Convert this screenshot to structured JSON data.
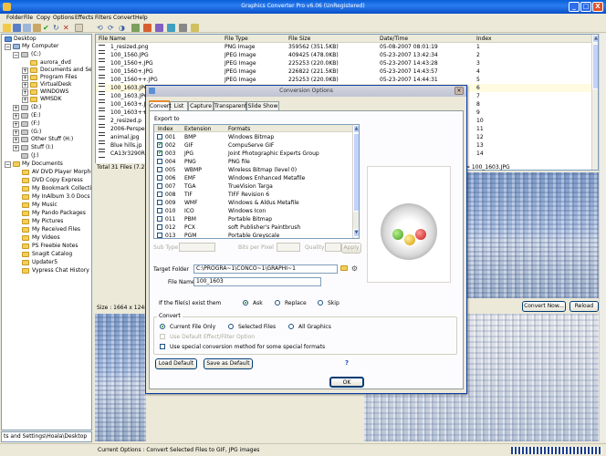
{
  "window": {
    "title": "Graphics Converter Pro v6.06 (UnRegistered)",
    "min": "_",
    "max": "□",
    "close": "X"
  },
  "menu": [
    "Folder",
    "File",
    "Copy",
    "Options",
    "Effects",
    "Filters",
    "Convert",
    "Help"
  ],
  "tree": {
    "items": [
      {
        "label": "Desktop"
      },
      {
        "label": "My Computer"
      },
      {
        "label": "(C:)"
      },
      {
        "label": "aurora_dvd"
      },
      {
        "label": "Documents and Settings"
      },
      {
        "label": "Program Files"
      },
      {
        "label": "VirtualDesk"
      },
      {
        "label": "WINDOWS"
      },
      {
        "label": "WMSDK"
      },
      {
        "label": "(D:)"
      },
      {
        "label": "(E:)"
      },
      {
        "label": "(F:)"
      },
      {
        "label": "(G:)"
      },
      {
        "label": "Other Stuff (H:)"
      },
      {
        "label": "Stuff (I:)"
      },
      {
        "label": "(J:)"
      },
      {
        "label": "My Documents"
      },
      {
        "label": "AV DVD Player Morpher"
      },
      {
        "label": "DVD Copy Express"
      },
      {
        "label": "My Bookmark Collections"
      },
      {
        "label": "My InAlbum 3.0 Docs"
      },
      {
        "label": "My Music"
      },
      {
        "label": "My Pando Packages"
      },
      {
        "label": "My Pictures"
      },
      {
        "label": "My Received Files"
      },
      {
        "label": "My Videos"
      },
      {
        "label": "PS Freebie Notes"
      },
      {
        "label": "SnagIt Catalog"
      },
      {
        "label": "Updater5"
      },
      {
        "label": "Vypress Chat History"
      }
    ],
    "path": "ts and Settings\\Hoala\\Desktop"
  },
  "files": {
    "headers": [
      "File Name",
      "File Type",
      "File Size",
      "Date/Time",
      "Index"
    ],
    "rows": [
      [
        "1_resized.png",
        "PNG Image",
        "359562 (351.5KB)",
        "05-08-2007  08:01:19",
        "1"
      ],
      [
        "100_1560.JPG",
        "JPEG Image",
        "409425 (478.0KB)",
        "05-23-2007  13:42:34",
        "2"
      ],
      [
        "100_1560+.JPG",
        "JPEG Image",
        "225253 (220.0KB)",
        "05-23-2007  14:43:28",
        "3"
      ],
      [
        "100_1560+.JPG",
        "JPEG Image",
        "226822 (221.5KB)",
        "05-23-2007  14:43:57",
        "4"
      ],
      [
        "100_1560++.JPG",
        "JPEG Image",
        "225253 (220.0KB)",
        "05-23-2007  14:44:31",
        "5"
      ],
      [
        "100_1603.JPG",
        "",
        "",
        "",
        "6"
      ],
      [
        "100_1603.JPG",
        "",
        "",
        "",
        "7"
      ],
      [
        "100_1603+.J",
        "",
        "",
        "",
        "8"
      ],
      [
        "100_1603++.J",
        "",
        "",
        "",
        "9"
      ],
      [
        "2_resized.p",
        "",
        "",
        "",
        "10"
      ],
      [
        "2006-Perspe",
        "",
        "",
        "",
        "11"
      ],
      [
        "animal.jpg",
        "",
        "",
        "",
        "12"
      ],
      [
        "Blue hills.jp",
        "",
        "",
        "",
        "13"
      ],
      [
        "CA13r3290R",
        "",
        "",
        "",
        "14"
      ]
    ],
    "total": "Total 31 Files (7.2 M"
  },
  "preview": {
    "filename": "= 100_1603.JPG",
    "size": "Size : 1664 x 1248",
    "convert_now": "Convert Now...",
    "reload": "Reload"
  },
  "status": "Current Options : Convert Selected Files to GIF, JPG images",
  "dialog": {
    "title": "Conversion Options",
    "tabs": [
      "Convert",
      "List",
      "Capture",
      "Transparent",
      "Slide Show"
    ],
    "export_to": "Export to",
    "format_headers": [
      "Index",
      "Extension",
      "Formats"
    ],
    "formats": [
      {
        "index": "001",
        "ext": "BMP",
        "name": "Windows Bitmap",
        "checked": false
      },
      {
        "index": "002",
        "ext": "GIF",
        "name": "CompuServe GIF",
        "checked": true
      },
      {
        "index": "003",
        "ext": "JPG",
        "name": "Joint Photographic Experts Group",
        "checked": true
      },
      {
        "index": "004",
        "ext": "PNG",
        "name": "PNG file",
        "checked": false
      },
      {
        "index": "005",
        "ext": "WBMP",
        "name": "Wireless Bitmap (level 0)",
        "checked": false
      },
      {
        "index": "006",
        "ext": "EMF",
        "name": "Windows Enhanced Metafile",
        "checked": false
      },
      {
        "index": "007",
        "ext": "TGA",
        "name": "TrueVision Targa",
        "checked": false
      },
      {
        "index": "008",
        "ext": "TIF",
        "name": "TIFF Revision 6",
        "checked": false
      },
      {
        "index": "009",
        "ext": "WMF",
        "name": "Windows & Aldus Metafile",
        "checked": false
      },
      {
        "index": "010",
        "ext": "ICO",
        "name": "Windows Icon",
        "checked": false
      },
      {
        "index": "011",
        "ext": "PBM",
        "name": "Portable Bitmap",
        "checked": false
      },
      {
        "index": "012",
        "ext": "PCX",
        "name": "soft Publisher's Paintbrush",
        "checked": false
      },
      {
        "index": "013",
        "ext": "PGM",
        "name": "Portable Greyscale",
        "checked": false
      }
    ],
    "sub_type": "Sub Type",
    "bits_per_pixel": "Bits per Pixel",
    "quality": "Quality",
    "apply": "Apply",
    "target_folder_label": "Target Folder",
    "target_folder": "C:\\PROGRA~1\\CONCO~1\\GRAPHI~1",
    "file_name_label": "File Name",
    "file_name": "100_1603",
    "exists_label": "If the file(s) exist them",
    "exists_options": [
      "Ask",
      "Replace",
      "Skip"
    ],
    "convert_group": "Convert",
    "convert_options": [
      "Current File Only",
      "Selected Files",
      "All Graphics"
    ],
    "default_effect": "Use Default Effect/Filter Option",
    "special_method": "Use special conversion method for some special formats",
    "load_default": "Load Default",
    "save_default": "Save as Default",
    "ok": "OK",
    "help": "?"
  }
}
